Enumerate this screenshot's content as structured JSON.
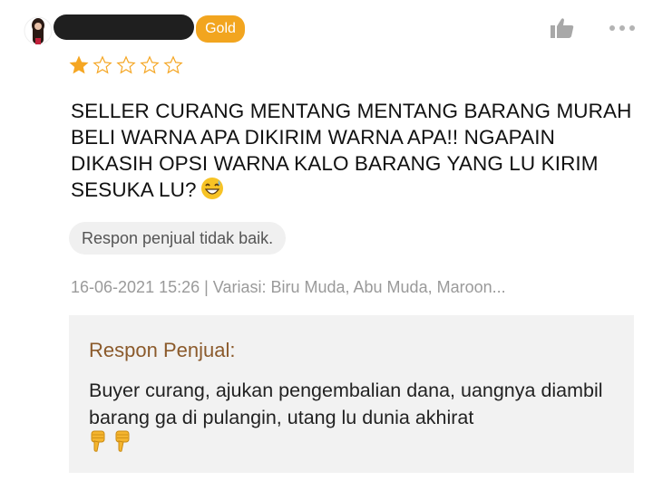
{
  "reviewer": {
    "badge": "Gold"
  },
  "rating": {
    "value": 1,
    "max": 5,
    "filled_color": "#f5a623",
    "empty_color": "#f5a623"
  },
  "review": {
    "text": "SELLER CURANG MENTANG MENTANG BARANG MURAH BELI WARNA APA DIKIRIM WARNA APA!! NGAPAIN DIKASIH OPSI WARNA KALO BARANG YANG LU KIRIM SESUKA LU?",
    "emoji": "grinning-sweat-emoji",
    "tag": "Respon penjual tidak baik.",
    "meta": "16-06-2021 15:26 | Variasi: Biru Muda, Abu Muda, Maroon..."
  },
  "actions": {
    "like_icon": "thumbs-up-icon",
    "more_icon": "more-dots-icon"
  },
  "seller_response": {
    "title": "Respon Penjual:",
    "text": "Buyer curang, ajukan pengembalian dana, uangnya diambil barang ga di pulangin, utang lu dunia akhirat",
    "emojis": [
      "thumbs-down-emoji",
      "thumbs-down-emoji"
    ]
  },
  "colors": {
    "badge": "#f2a51f",
    "seller_title": "#8b5a2b",
    "meta": "#9a9a9a"
  }
}
